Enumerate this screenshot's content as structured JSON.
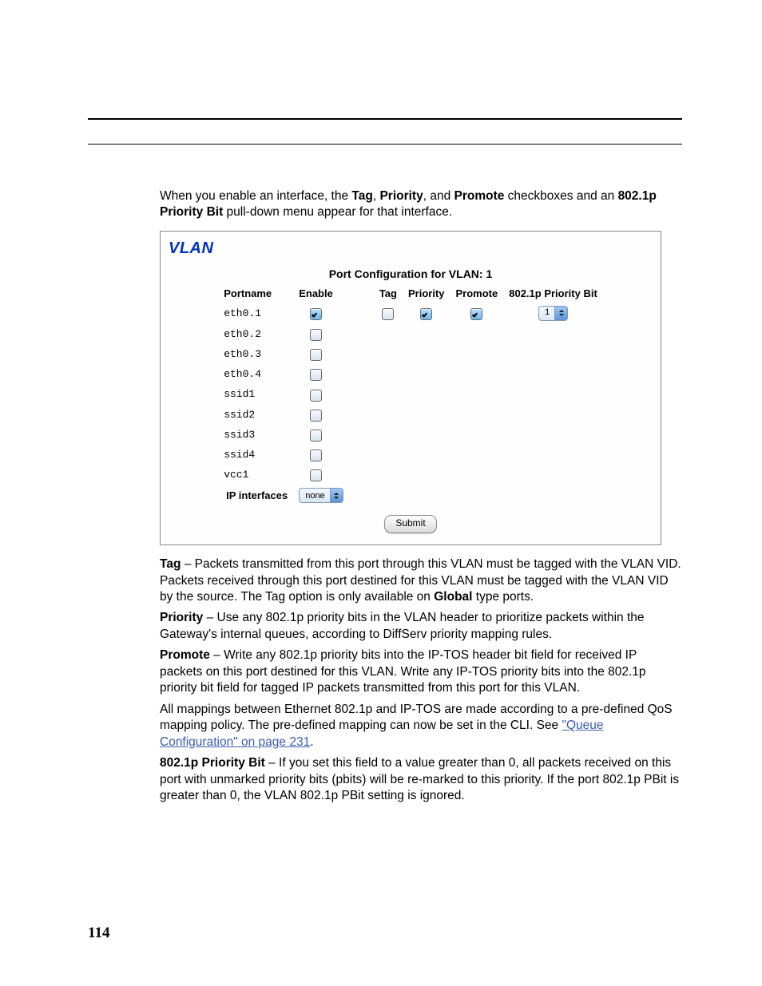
{
  "intro": {
    "part1": "When you enable an interface, the ",
    "tag": "Tag",
    "sep1": ", ",
    "priority": "Priority",
    "sep2": ", and ",
    "promote": "Promote",
    "part2": " checkboxes and an ",
    "pbit": "802.1p Priority Bit",
    "part3": " pull-down menu appear for that interface."
  },
  "panel": {
    "title": "VLAN",
    "subtitle": "Port Configuration for VLAN: 1",
    "headers": {
      "portname": "Portname",
      "enable": "Enable",
      "tag": "Tag",
      "priority": "Priority",
      "promote": "Promote",
      "pbit": "802.1p Priority Bit"
    },
    "rows": [
      {
        "name": "eth0.1",
        "enable": true,
        "expanded": true,
        "tag": false,
        "priority": true,
        "promote": true,
        "pbit": "1"
      },
      {
        "name": "eth0.2",
        "enable": false,
        "expanded": false
      },
      {
        "name": "eth0.3",
        "enable": false,
        "expanded": false
      },
      {
        "name": "eth0.4",
        "enable": false,
        "expanded": false
      },
      {
        "name": "ssid1",
        "enable": false,
        "expanded": false
      },
      {
        "name": "ssid2",
        "enable": false,
        "expanded": false
      },
      {
        "name": "ssid3",
        "enable": false,
        "expanded": false
      },
      {
        "name": "ssid4",
        "enable": false,
        "expanded": false
      },
      {
        "name": "vcc1",
        "enable": false,
        "expanded": false
      }
    ],
    "ip_if_label": "IP interfaces",
    "ip_if_value": "none",
    "submit": "Submit"
  },
  "desc": {
    "tag": {
      "label": "Tag",
      "text1": " – Packets transmitted from this port through this VLAN must be tagged with the VLAN VID. Packets received through this port destined for this VLAN must be tagged with the VLAN VID by the source. The Tag option is only available on ",
      "global": "Global",
      "text2": " type ports."
    },
    "priority": {
      "label": "Priority",
      "text": " – Use any 802.1p priority bits in the VLAN header to prioritize packets within the Gateway's internal queues, according to DiffServ priority mapping rules."
    },
    "promote": {
      "label": "Promote",
      "text": " – Write any 802.1p priority bits into the IP-TOS header bit field for received IP packets on this port destined for this VLAN. Write any IP-TOS priority bits into the 802.1p priority bit field for tagged IP packets transmitted from this port for this VLAN."
    },
    "mapping": {
      "text1": "All mappings between Ethernet 802.1p and IP-TOS are made according to a pre-defined QoS mapping policy. The pre-defined mapping can now be set in the CLI. See ",
      "link": "\"Queue Configuration\" on page 231",
      "text2": "."
    },
    "pbit": {
      "label": "802.1p Priority Bit",
      "text": " – If you set this field to a value greater than 0, all packets received on this port with unmarked priority bits (pbits) will be re-marked to this priority. If the port 802.1p PBit is greater than 0, the VLAN 802.1p PBit setting is ignored."
    }
  },
  "page_number": "114"
}
